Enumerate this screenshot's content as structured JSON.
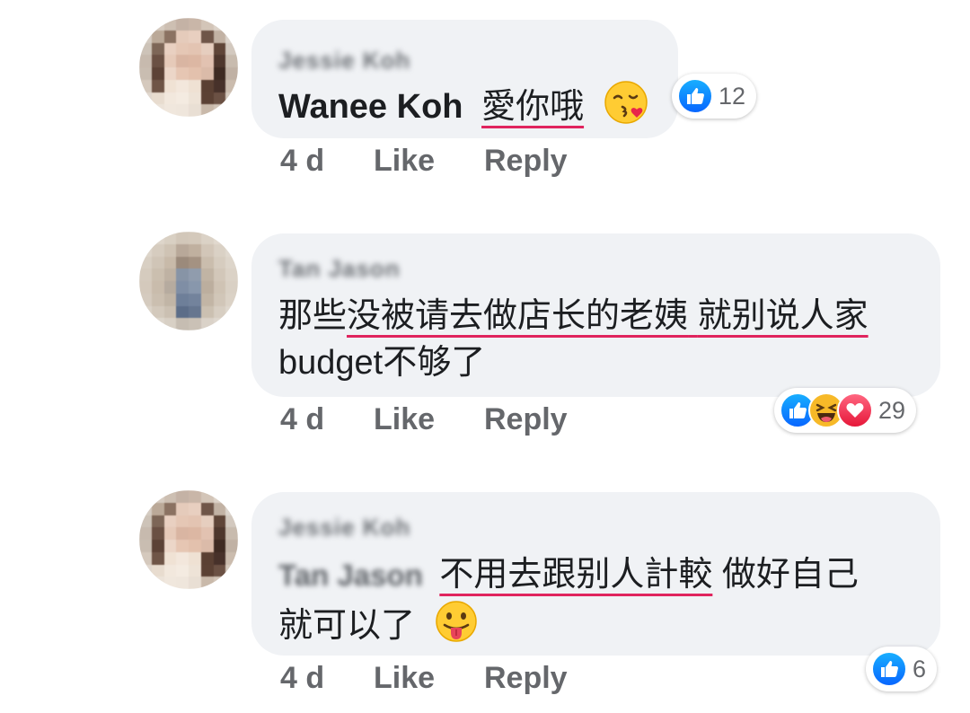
{
  "comments": [
    {
      "author_blurred": "Jessie Koh",
      "mention": "Wanee Koh",
      "text": "愛你哦",
      "emoji": "kissing-face-with-heart-emoji",
      "time": "4 d",
      "like_label": "Like",
      "reply_label": "Reply",
      "reactions": {
        "types": [
          "like"
        ],
        "count": "12"
      }
    },
    {
      "author_blurred": "Tan Jason",
      "text_line1_a": "那些",
      "text_line1_b": "没被请去做店长的老姨",
      "text_line1_c": " ",
      "text_line1_d": "就别说人家",
      "text_line2": "budget不够了",
      "time": "4 d",
      "like_label": "Like",
      "reply_label": "Reply",
      "reactions": {
        "types": [
          "like",
          "haha",
          "love"
        ],
        "count": "29"
      }
    },
    {
      "author_blurred": "Jessie Koh",
      "mention_blurred": "Tan Jason",
      "text_underlined": "不用去跟别人計較",
      "text_line1_rest": " 做好自己",
      "text_line2": "就可以了",
      "emoji": "tongue-out-face-emoji",
      "time": "4 d",
      "like_label": "Like",
      "reply_label": "Reply",
      "reactions": {
        "types": [
          "like"
        ],
        "count": "6"
      }
    }
  ],
  "colors": {
    "bubble": "#f0f2f5",
    "like_blue": "#0866ff",
    "meta_gray": "#65676b",
    "underline_red": "#e0245e"
  }
}
